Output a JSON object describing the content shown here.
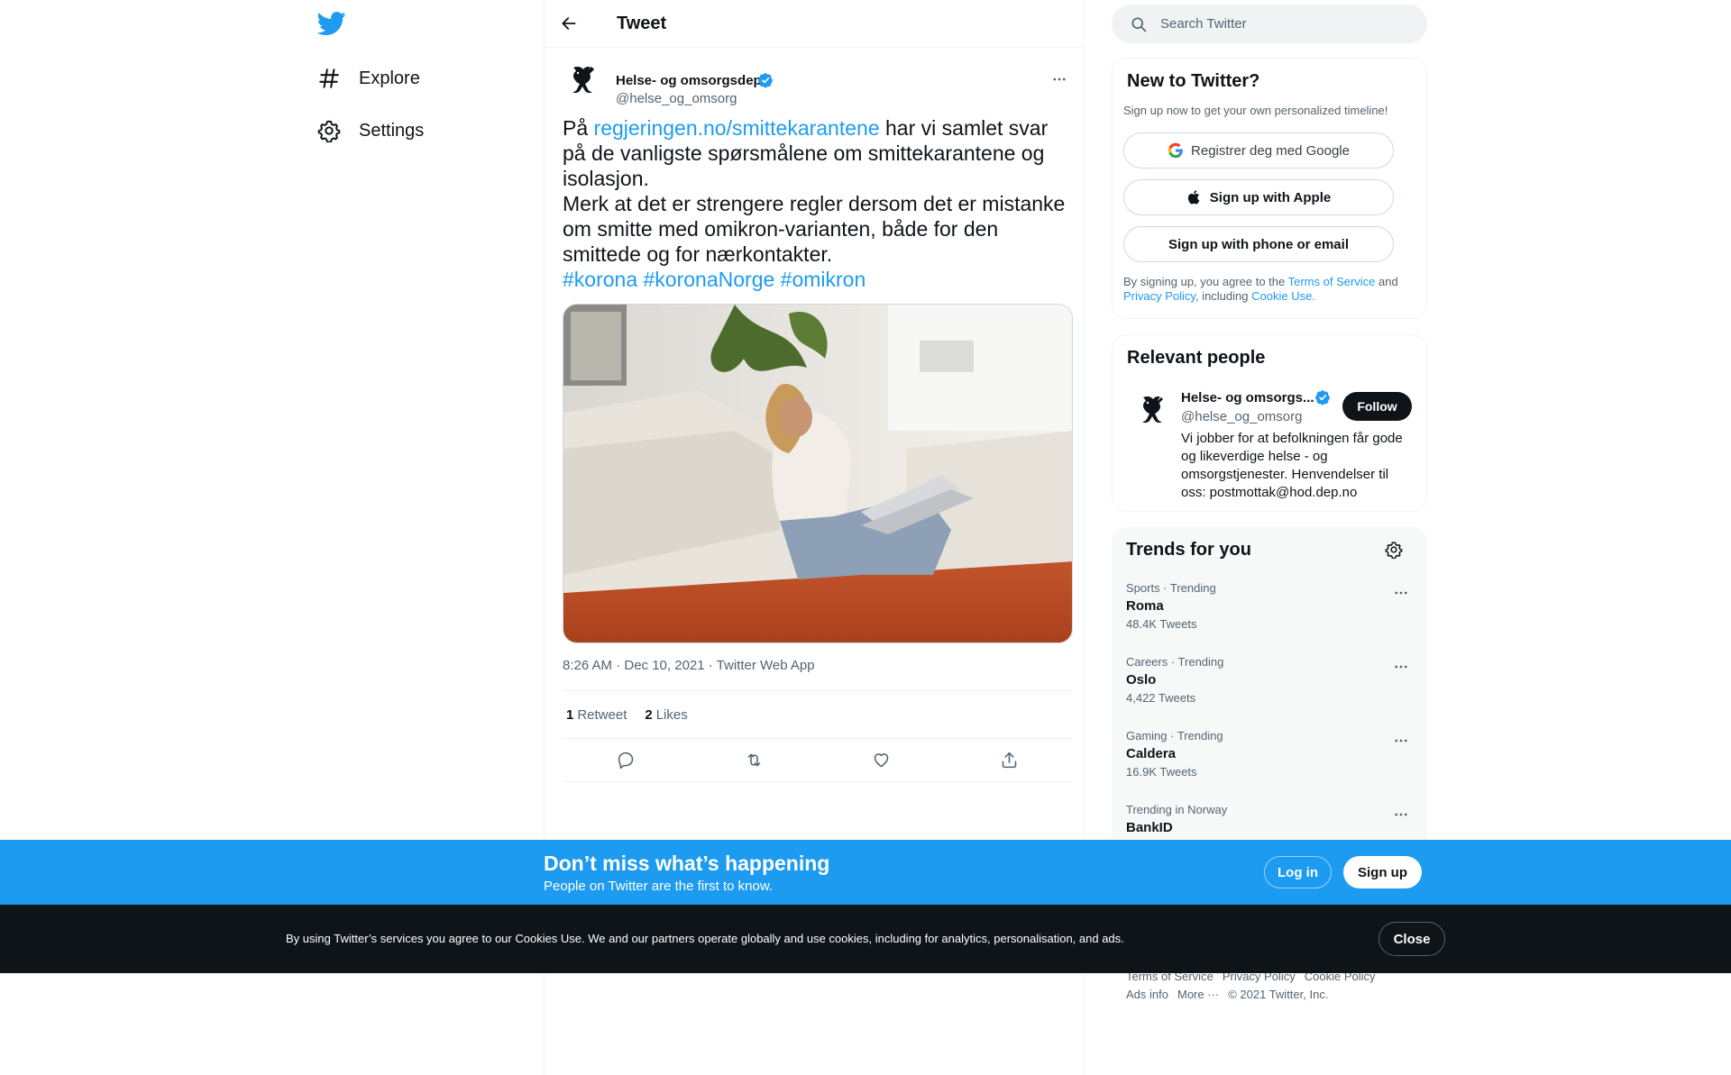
{
  "nav": {
    "logo_icon": "twitter-bird-icon",
    "items": [
      {
        "label": "Explore",
        "icon": "hashtag-icon"
      },
      {
        "label": "Settings",
        "icon": "gear-icon"
      }
    ]
  },
  "header": {
    "title": "Tweet"
  },
  "tweet": {
    "author_name": "Helse- og omsorgsdep",
    "author_handle": "@helse_og_omsorg",
    "text_prefix": "På ",
    "link": "regjeringen.no/smittekarantene",
    "text_line1_rest": " har vi samlet svar på de vanligste spørsmålene om smittekarantene og isolasjon.",
    "text_line2": "Merk at det er strengere regler dersom det er mistanke om smitte med omikron-varianten, både for den smittede og for nærkontakter.",
    "hashtags": [
      "#korona",
      "#koronaNorge",
      "#omikron"
    ],
    "timestamp": "8:26 AM · Dec 10, 2021 · Twitter Web App",
    "retweet_count": "1",
    "retweet_label": "Retweet",
    "like_count": "2",
    "like_label": "Likes"
  },
  "search": {
    "placeholder": "Search Twitter"
  },
  "signup_card": {
    "title": "New to Twitter?",
    "subtitle": "Sign up now to get your own personalized timeline!",
    "google_label": "Registrer deg med Google",
    "apple_label": "Sign up with Apple",
    "phone_label": "Sign up with phone or email",
    "legal_1": "By signing up, you agree to the ",
    "terms": "Terms of Service",
    "legal_2": " and ",
    "privacy": "Privacy Policy",
    "legal_3": ", including ",
    "cookie": "Cookie Use."
  },
  "people_card": {
    "title": "Relevant people",
    "name": "Helse- og omsorgs...",
    "handle": "@helse_og_omsorg",
    "follow_label": "Follow",
    "bio": "Vi jobber for at befolkningen får gode og likeverdige helse - og omsorgstjenester. Henvendelser til oss: postmottak@hod.dep.no"
  },
  "trends_card": {
    "title": "Trends for you",
    "items": [
      {
        "meta": "Sports · Trending",
        "name": "Roma",
        "count": "48.4K Tweets"
      },
      {
        "meta": "Careers · Trending",
        "name": "Oslo",
        "count": "4,422 Tweets"
      },
      {
        "meta": "Gaming · Trending",
        "name": "Caldera",
        "count": "16.9K Tweets"
      },
      {
        "meta": "Trending in Norway",
        "name": "BankID",
        "count": ""
      }
    ]
  },
  "footer": {
    "links": [
      "Terms of Service",
      "Privacy Policy",
      "Cookie Policy",
      "Ads info",
      "More ···",
      "© 2021 Twitter, Inc."
    ]
  },
  "promo": {
    "title": "Don’t miss what’s happening",
    "subtitle": "People on Twitter are the first to know.",
    "login_label": "Log in",
    "signup_label": "Sign up"
  },
  "cookie_banner": {
    "text": "By using Twitter’s services you agree to our Cookies Use. We and our partners operate globally and use cookies, including for analytics, personalisation, and ads.",
    "close_label": "Close"
  },
  "colors": {
    "brand_blue": "#1d9bf0",
    "dark": "#0f1419",
    "muted": "#536471",
    "border": "#eff3f4"
  }
}
